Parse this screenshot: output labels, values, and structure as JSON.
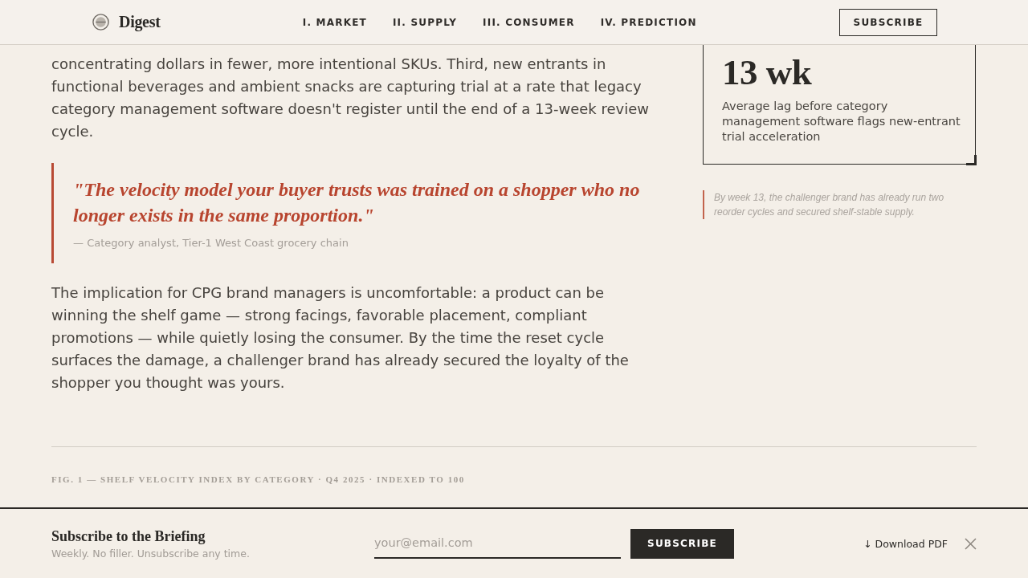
{
  "header": {
    "logo": "Digest",
    "nav": [
      {
        "label": "I. MARKET"
      },
      {
        "label": "II. SUPPLY"
      },
      {
        "label": "III. CONSUMER"
      },
      {
        "label": "IV. PREDICTION"
      }
    ],
    "subscribe_button": "SUBSCRIBE"
  },
  "article": {
    "blocks": [
      {
        "kind": "paragraph",
        "text": "concentrating dollars in fewer, more intentional SKUs. Third, new entrants in functional beverages and ambient snacks are capturing trial at a rate that legacy category management software doesn't register until the end of a 13-week review cycle."
      },
      {
        "kind": "quote",
        "text": "\"The velocity model your buyer trusts was trained on a shopper who no longer exists in the same proportion.\"",
        "attribution": "— Category analyst, Tier-1 West Coast grocery chain"
      },
      {
        "kind": "paragraph",
        "text": "The implication for CPG brand managers is uncomfortable: a product can be winning the shelf game — strong facings, favorable placement, compliant promotions — while quietly losing the consumer. By the time the reset cycle surfaces the damage, a challenger brand has already secured the loyalty of the shopper you thought was yours."
      }
    ]
  },
  "sidebar": {
    "stat": {
      "value": "13 wk",
      "caption": "Average lag before category management software flags new-entrant trial acceleration"
    },
    "note": "By week 13, the challenger brand has already run two reorder cycles and secured shelf-stable supply."
  },
  "figure": {
    "caption": "FIG. 1 — SHELF VELOCITY INDEX BY CATEGORY · Q4 2025 · INDEXED TO 100"
  },
  "subscribe_bar": {
    "title": "Subscribe to the Briefing",
    "subtitle": "Weekly. No filler. Unsubscribe any time.",
    "email": {
      "placeholder": "your@email.com"
    },
    "button": "SUBSCRIBE",
    "download_link": "↓ Download PDF"
  }
}
